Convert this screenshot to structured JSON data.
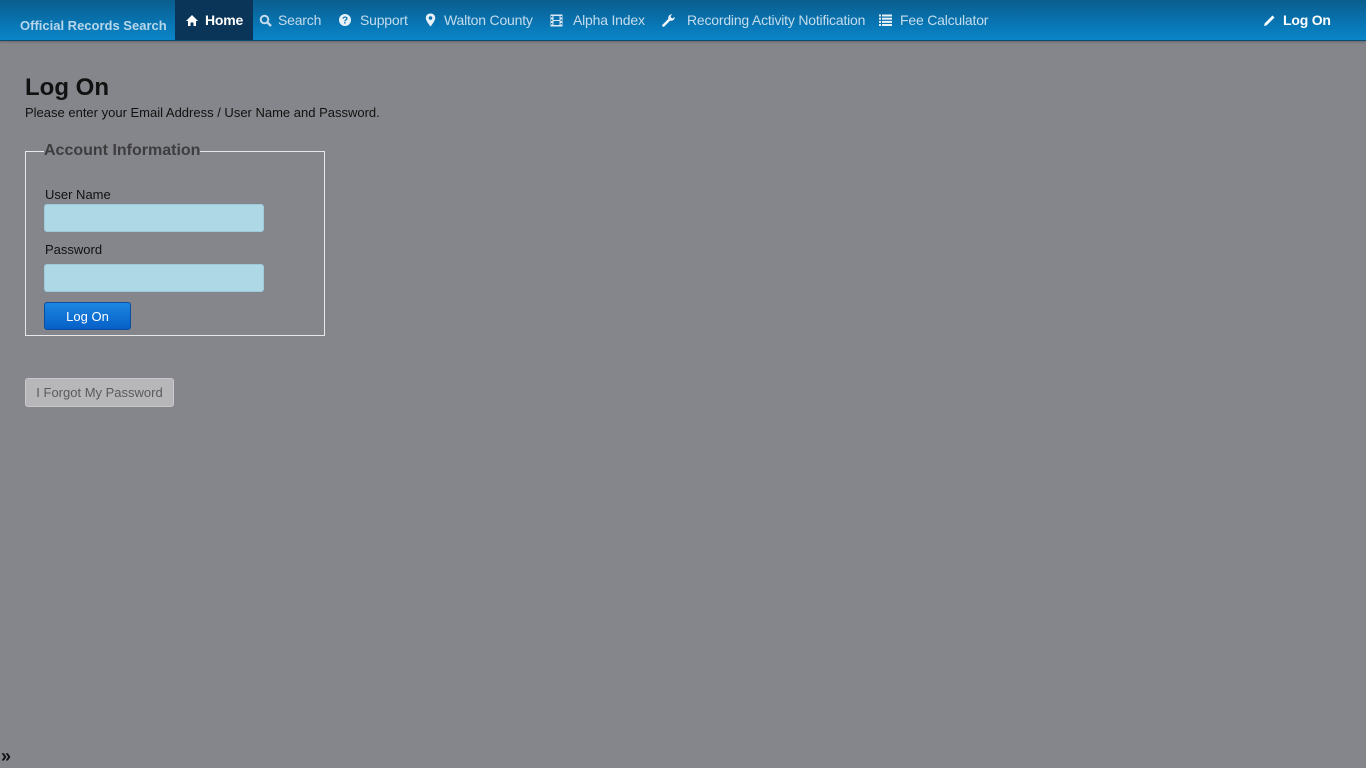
{
  "navbar": {
    "brand": "Official Records Search",
    "items": [
      {
        "label": "Home",
        "icon": "home-icon",
        "active": true
      },
      {
        "label": "Search",
        "icon": "search-icon"
      },
      {
        "label": "Support",
        "icon": "question-circle-icon"
      },
      {
        "label": "Walton County",
        "icon": "map-marker-icon"
      },
      {
        "label": "Alpha Index",
        "icon": "film-icon"
      },
      {
        "label": "Recording Activity Notification",
        "icon": "wrench-icon"
      },
      {
        "label": "Fee Calculator",
        "icon": "list-icon"
      }
    ],
    "login": {
      "label": "Log On",
      "icon": "pencil-icon"
    }
  },
  "page": {
    "title": "Log On",
    "subtitle": "Please enter your Email Address / User Name and Password."
  },
  "form": {
    "legend": "Account Information",
    "username_label": "User Name",
    "username_value": "",
    "password_label": "Password",
    "password_value": "",
    "submit_label": "Log On"
  },
  "forgot_label": "I Forgot My Password",
  "sidebar_toggle": "»",
  "colors": {
    "navbar": "#0873b0",
    "active_nav": "#0b3558",
    "background": "#85868b",
    "input": "#aed8e6",
    "primary_button": "#0a6fd6"
  }
}
